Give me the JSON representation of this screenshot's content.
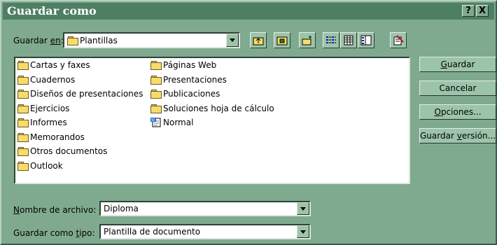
{
  "window": {
    "title": "Guardar como",
    "help_btn": "?",
    "close_btn": "X"
  },
  "save_in": {
    "label_pre": "Guardar ",
    "label_u": "en",
    "label_post": ":",
    "value": "Plantillas"
  },
  "toolbar": {
    "icons": [
      "up-one-level-icon",
      "desktop-icon",
      "new-folder-icon",
      "list-view-icon",
      "details-view-icon",
      "properties-view-icon",
      "commands-icon"
    ]
  },
  "files": [
    {
      "name": "Cartas y faxes",
      "type": "folder"
    },
    {
      "name": "Cuadernos",
      "type": "folder"
    },
    {
      "name": "Diseños de presentaciones",
      "type": "folder"
    },
    {
      "name": "Ejercicios",
      "type": "folder"
    },
    {
      "name": "Informes",
      "type": "folder"
    },
    {
      "name": "Memorandos",
      "type": "folder"
    },
    {
      "name": "Otros documentos",
      "type": "folder"
    },
    {
      "name": "Outlook",
      "type": "folder"
    },
    {
      "name": "Páginas Web",
      "type": "folder"
    },
    {
      "name": "Presentaciones",
      "type": "folder"
    },
    {
      "name": "Publicaciones",
      "type": "folder"
    },
    {
      "name": "Soluciones hoja de cálculo",
      "type": "folder"
    },
    {
      "name": "Normal",
      "type": "document"
    }
  ],
  "buttons": {
    "save": {
      "u": "G",
      "rest": "uardar"
    },
    "cancel": {
      "label": "Cancelar"
    },
    "options": {
      "u": "O",
      "rest": "pciones..."
    },
    "save_version": {
      "pre": "Guardar ",
      "u": "v",
      "rest": "ersión..."
    }
  },
  "filename": {
    "label_u": "N",
    "label_rest": "ombre de archivo:",
    "value": "Diploma"
  },
  "filetype": {
    "label_pre": "Guardar como ",
    "label_u": "t",
    "label_rest": "ipo:",
    "value": "Plantilla de documento"
  }
}
